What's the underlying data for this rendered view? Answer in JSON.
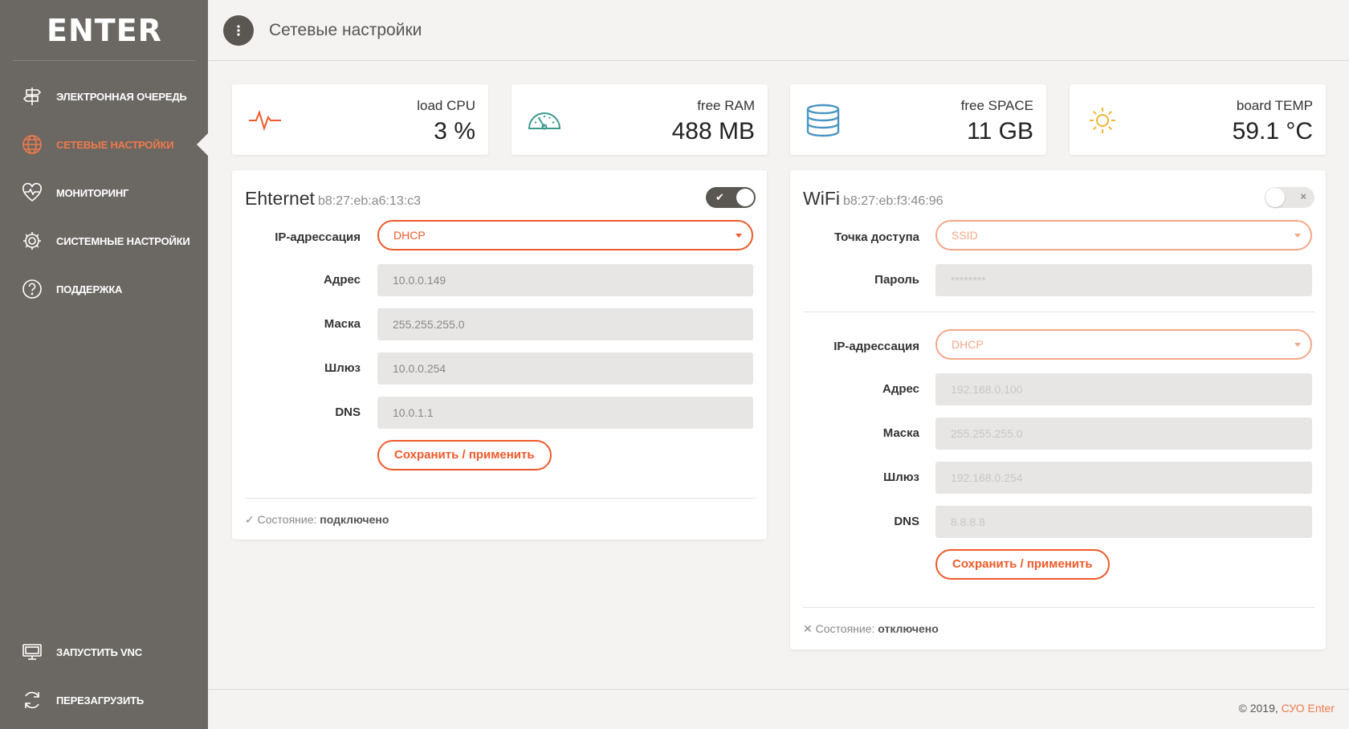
{
  "brand": {
    "logo": "ENTER"
  },
  "sidebar": {
    "items": [
      {
        "label": "Электронная очередь",
        "icon": "signpost-icon"
      },
      {
        "label": "Сетевые настройки",
        "icon": "globe-icon",
        "active": true
      },
      {
        "label": "Мониторинг",
        "icon": "heart-pulse-icon"
      },
      {
        "label": "Системные настройки",
        "icon": "gear-icon"
      },
      {
        "label": "Поддержка",
        "icon": "help-icon"
      }
    ],
    "bottom": [
      {
        "label": "Запустить VNC",
        "icon": "monitor-icon"
      },
      {
        "label": "Перезагрузить",
        "icon": "reload-icon"
      }
    ]
  },
  "header": {
    "title": "Сетевые настройки"
  },
  "stats": [
    {
      "label": "load CPU",
      "value": "3 %",
      "icon": "pulse-icon"
    },
    {
      "label": "free RAM",
      "value": "488 MB",
      "icon": "speedometer-icon"
    },
    {
      "label": "free SPACE",
      "value": "11 GB",
      "icon": "database-icon"
    },
    {
      "label": "board TEMP",
      "value": "59.1 °C",
      "icon": "sun-icon"
    }
  ],
  "ethernet": {
    "title": "Ehternet",
    "mac": "b8:27:eb:a6:13:c3",
    "enabled": true,
    "toggle_mark": "✔",
    "ip_label": "IP-адрессация",
    "ip_mode": "DHCP",
    "fields": [
      {
        "label": "Адрес",
        "value": "10.0.0.149"
      },
      {
        "label": "Маска",
        "value": "255.255.255.0"
      },
      {
        "label": "Шлюз",
        "value": "10.0.0.254"
      },
      {
        "label": "DNS",
        "value": "10.0.1.1"
      }
    ],
    "save_label": "Сохранить / применить",
    "status_icon": "✓",
    "status_label": "Состояние:",
    "status_value": "подключено"
  },
  "wifi": {
    "title": "WiFi",
    "mac": "b8:27:eb:f3:46:96",
    "enabled": false,
    "toggle_mark": "×",
    "ssid_label": "Точка доступа",
    "ssid_value": "SSID",
    "password_label": "Пароль",
    "password_value": "********",
    "ip_label": "IP-адрессация",
    "ip_mode": "DHCP",
    "fields": [
      {
        "label": "Адрес",
        "value": "192.168.0.100"
      },
      {
        "label": "Маска",
        "value": "255.255.255.0"
      },
      {
        "label": "Шлюз",
        "value": "192.168.0.254"
      },
      {
        "label": "DNS",
        "value": "8.8.8.8"
      }
    ],
    "save_label": "Сохранить / применить",
    "status_icon": "✕",
    "status_label": "Состояние:",
    "status_value": "отключено"
  },
  "footer": {
    "copyright_prefix": "© 2019,",
    "copyright_link": "СУО Enter"
  },
  "colors": {
    "accent": "#ee5a2a",
    "sidebar": "#6b6864",
    "background": "#f4f3f1"
  }
}
